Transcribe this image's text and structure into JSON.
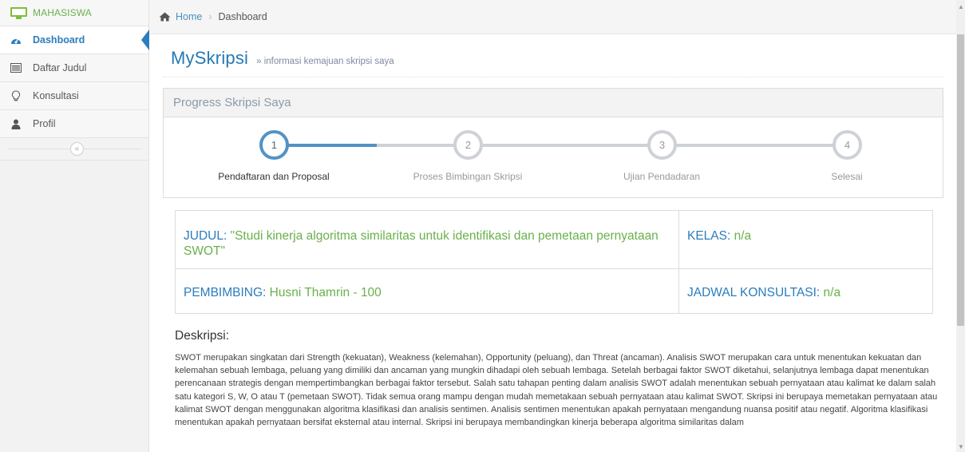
{
  "sidebar": {
    "header": "MAHASISWA",
    "items": [
      {
        "label": "Dashboard",
        "icon": "dashboard-icon",
        "active": true
      },
      {
        "label": "Daftar Judul",
        "icon": "list-icon",
        "active": false
      },
      {
        "label": "Konsultasi",
        "icon": "lightbulb-icon",
        "active": false
      },
      {
        "label": "Profil",
        "icon": "user-icon",
        "active": false
      }
    ],
    "collapse_symbol": "«"
  },
  "breadcrumb": {
    "home": "Home",
    "separator": "›",
    "current": "Dashboard"
  },
  "page_header": {
    "title": "MySkripsi",
    "subtitle": "» informasi kemajuan skripsi saya"
  },
  "progress": {
    "title": "Progress Skripsi Saya",
    "steps": [
      {
        "number": "1",
        "label": "Pendaftaran dan Proposal",
        "done": true
      },
      {
        "number": "2",
        "label": "Proses Bimbingan Skripsi",
        "done": false
      },
      {
        "number": "3",
        "label": "Ujian Pendadaran",
        "done": false
      },
      {
        "number": "4",
        "label": "Selesai",
        "done": false
      }
    ]
  },
  "info": {
    "judul_label": "JUDUL:",
    "judul_value": " \"Studi kinerja algoritma similaritas untuk identifikasi dan pemetaan pernyataan SWOT\"",
    "kelas_label": "KELAS:",
    "kelas_value": " n/a",
    "pembimbing_label": "PEMBIMBING:",
    "pembimbing_value": " Husni Thamrin - 100",
    "jadwal_label": "JADWAL KONSULTASI:",
    "jadwal_value": " n/a"
  },
  "deskripsi": {
    "title": "Deskripsi:",
    "text": "SWOT merupakan singkatan dari Strength (kekuatan), Weakness (kelemahan), Opportunity (peluang), dan Threat (ancaman). Analisis SWOT merupakan cara untuk menentukan kekuatan dan kelemahan sebuah lembaga, peluang yang dimiliki dan ancaman yang mungkin dihadapi oleh sebuah lembaga. Setelah berbagai faktor SWOT diketahui, selanjutnya lembaga dapat menentukan perencanaan strategis dengan mempertimbangkan berbagai faktor tersebut. Salah satu tahapan penting dalam analisis SWOT adalah menentukan sebuah pernyataan atau kalimat ke dalam salah satu kategori S, W, O atau T (pemetaan SWOT). Tidak semua orang mampu dengan mudah memetakaan sebuah pernyataan atau kalimat SWOT. Skripsi ini berupaya memetakan pernyataan atau kalimat SWOT dengan menggunakan algoritma klasifikasi dan analisis sentimen. Analisis sentimen menentukan apakah pernyataan mengandung nuansa positif atau negatif. Algoritma klasifikasi menentukan apakah pernyataan bersifat eksternal atau internal. Skripsi ini berupaya membandingkan kinerja beberapa algoritma similaritas dalam"
  },
  "colors": {
    "accent": "#2b7dbc",
    "done_step": "#5293c4",
    "pending_step": "#ced1d6",
    "value_green": "#6ab04c"
  }
}
